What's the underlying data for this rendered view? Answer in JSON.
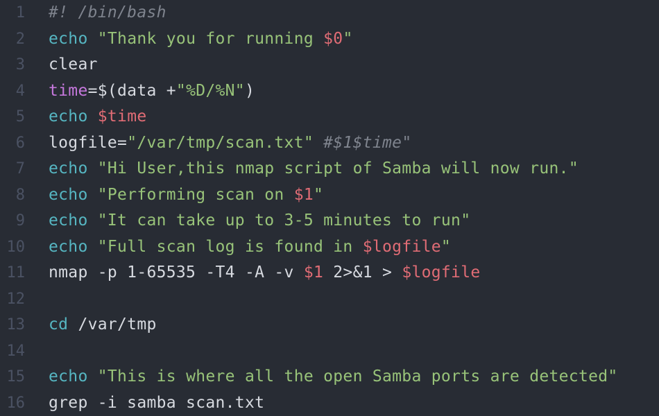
{
  "editor": {
    "language": "bash",
    "colors": {
      "background": "#282c34",
      "line_number": "#4b5263",
      "plain": "#d7dae0",
      "builtin": "#56b6c2",
      "string": "#98c379",
      "variable": "#e06c75",
      "comment": "#7f848e",
      "keyword": "#c678dd"
    },
    "lines": [
      {
        "number": "1",
        "tokens": [
          {
            "text": "#! /bin/bash",
            "kind": "comment"
          }
        ]
      },
      {
        "number": "2",
        "tokens": [
          {
            "text": "echo",
            "kind": "builtin"
          },
          {
            "text": " ",
            "kind": "plain"
          },
          {
            "text": "\"Thank you for running ",
            "kind": "string"
          },
          {
            "text": "$0",
            "kind": "var"
          },
          {
            "text": "\"",
            "kind": "string"
          }
        ]
      },
      {
        "number": "3",
        "tokens": [
          {
            "text": "clear",
            "kind": "plain"
          }
        ]
      },
      {
        "number": "4",
        "tokens": [
          {
            "text": "time",
            "kind": "keyword"
          },
          {
            "text": "=$(data +",
            "kind": "plain"
          },
          {
            "text": "\"%D/%N\"",
            "kind": "string"
          },
          {
            "text": ")",
            "kind": "plain"
          }
        ]
      },
      {
        "number": "5",
        "tokens": [
          {
            "text": "echo",
            "kind": "builtin"
          },
          {
            "text": " ",
            "kind": "plain"
          },
          {
            "text": "$time",
            "kind": "var"
          }
        ]
      },
      {
        "number": "6",
        "tokens": [
          {
            "text": "logfile=",
            "kind": "plain"
          },
          {
            "text": "\"/var/tmp/scan.txt\"",
            "kind": "string"
          },
          {
            "text": " ",
            "kind": "plain"
          },
          {
            "text": "#$1$time\"",
            "kind": "comment"
          }
        ]
      },
      {
        "number": "7",
        "tokens": [
          {
            "text": "echo",
            "kind": "builtin"
          },
          {
            "text": " ",
            "kind": "plain"
          },
          {
            "text": "\"Hi User,this nmap script of Samba will now run.\"",
            "kind": "string"
          }
        ]
      },
      {
        "number": "8",
        "tokens": [
          {
            "text": "echo",
            "kind": "builtin"
          },
          {
            "text": " ",
            "kind": "plain"
          },
          {
            "text": "\"Performing scan on ",
            "kind": "string"
          },
          {
            "text": "$1",
            "kind": "var"
          },
          {
            "text": "\"",
            "kind": "string"
          }
        ]
      },
      {
        "number": "9",
        "tokens": [
          {
            "text": "echo",
            "kind": "builtin"
          },
          {
            "text": " ",
            "kind": "plain"
          },
          {
            "text": "\"It can take up to 3-5 minutes to run\"",
            "kind": "string"
          }
        ]
      },
      {
        "number": "10",
        "tokens": [
          {
            "text": "echo",
            "kind": "builtin"
          },
          {
            "text": " ",
            "kind": "plain"
          },
          {
            "text": "\"Full scan log is found in ",
            "kind": "string"
          },
          {
            "text": "$logfile",
            "kind": "var"
          },
          {
            "text": "\"",
            "kind": "string"
          }
        ]
      },
      {
        "number": "11",
        "tokens": [
          {
            "text": "nmap -p 1-65535 -T4 -A -v ",
            "kind": "plain"
          },
          {
            "text": "$1",
            "kind": "var"
          },
          {
            "text": " 2>&1 > ",
            "kind": "plain"
          },
          {
            "text": "$logfile",
            "kind": "var"
          }
        ]
      },
      {
        "number": "12",
        "tokens": []
      },
      {
        "number": "13",
        "tokens": [
          {
            "text": "cd",
            "kind": "builtin"
          },
          {
            "text": " /var/tmp",
            "kind": "plain"
          }
        ]
      },
      {
        "number": "14",
        "tokens": []
      },
      {
        "number": "15",
        "tokens": [
          {
            "text": "echo",
            "kind": "builtin"
          },
          {
            "text": " ",
            "kind": "plain"
          },
          {
            "text": "\"This is where all the open Samba ports are detected\"",
            "kind": "string"
          }
        ]
      },
      {
        "number": "16",
        "tokens": [
          {
            "text": "grep -i samba scan.txt",
            "kind": "plain"
          }
        ]
      }
    ]
  }
}
